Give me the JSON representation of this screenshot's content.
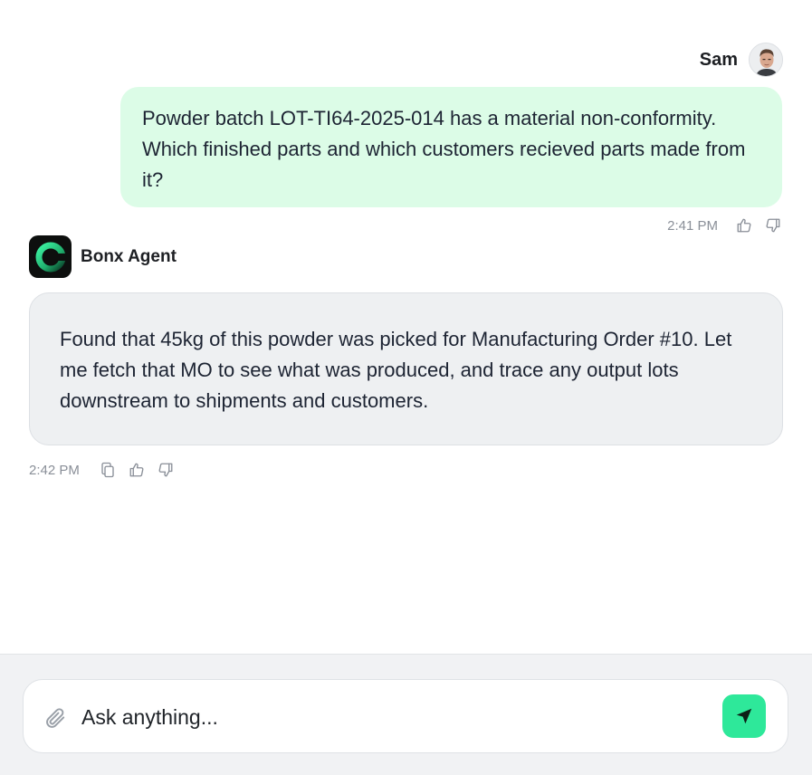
{
  "user_message": {
    "author": "Sam",
    "avatar_icon": "user-photo-avatar",
    "text": "Powder batch LOT-TI64-2025-014 has a material non-conformity. Which finished parts and which customers recieved parts made from it?",
    "time": "2:41 PM",
    "icons": [
      "thumbs-up-icon",
      "thumbs-down-icon"
    ],
    "bubble_color": "#dcfce7"
  },
  "agent_message": {
    "author": "Bonx Agent",
    "logo_icon": "bonx-logo",
    "text": "Found that 45kg of this powder was picked for Manufacturing Order #10. Let me fetch that MO to see what was produced, and trace any output lots downstream to shipments and customers.",
    "time": "2:42 PM",
    "icons": [
      "copy-icon",
      "thumbs-up-icon",
      "thumbs-down-icon"
    ],
    "bubble_color": "#eef0f2"
  },
  "composer": {
    "placeholder": "Ask anything...",
    "value": "",
    "attach_icon": "paperclip-icon",
    "send_icon": "send-arrow-icon",
    "send_color": "#2ee89a"
  }
}
